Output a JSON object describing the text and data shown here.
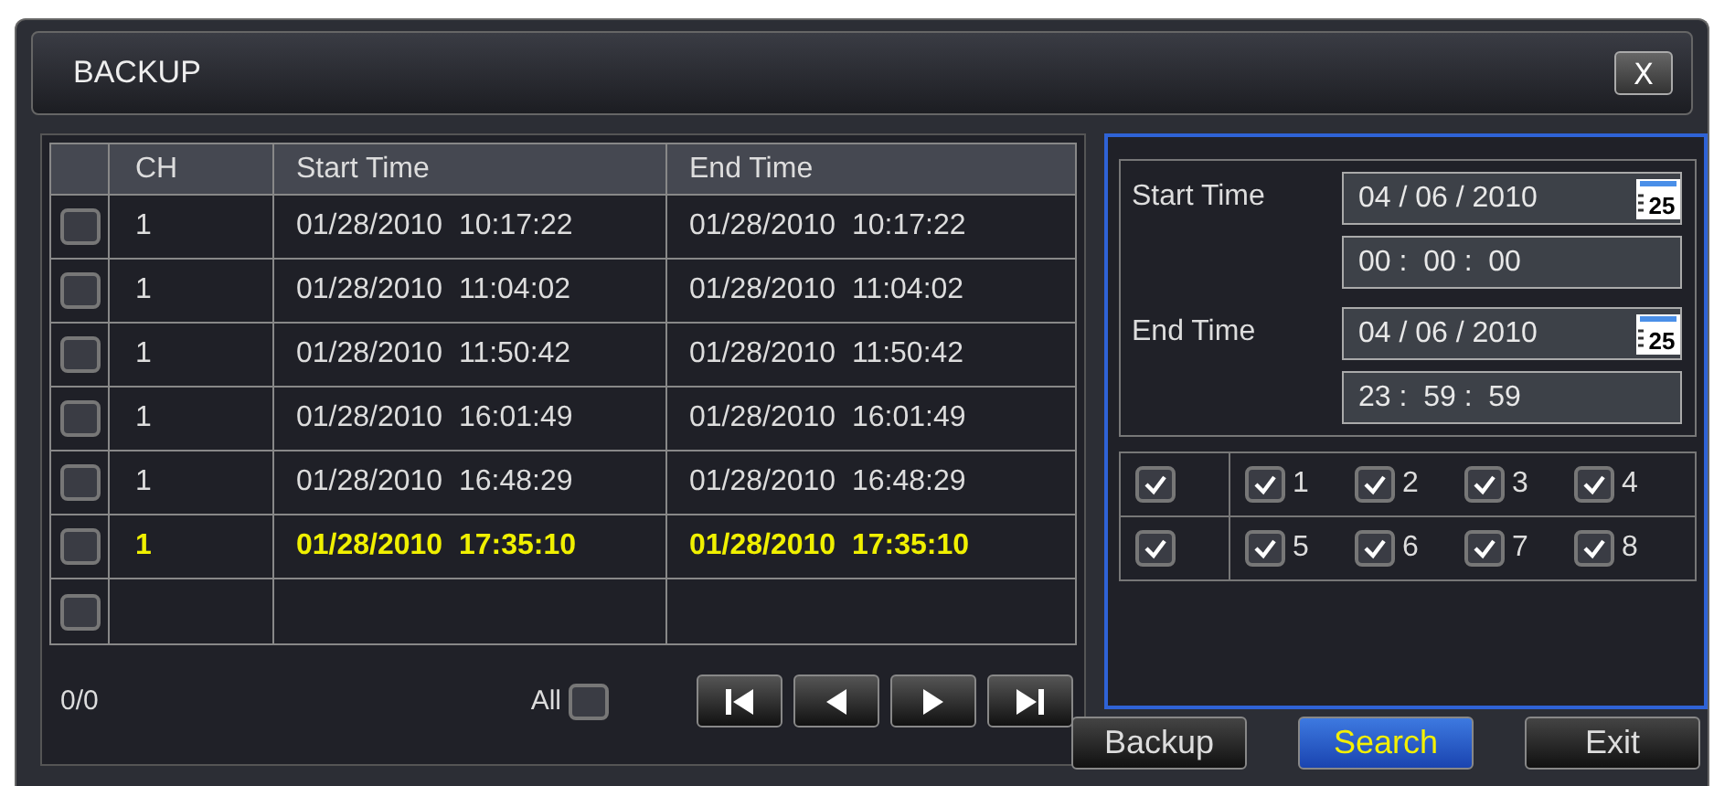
{
  "window": {
    "title": "BACKUP",
    "close": "X"
  },
  "table": {
    "columns": [
      "CH",
      "Start Time",
      "End Time"
    ],
    "rows": [
      {
        "checked": false,
        "selected": false,
        "ch": "1",
        "start": "01/28/2010  10:17:22",
        "end": "01/28/2010  10:17:22"
      },
      {
        "checked": false,
        "selected": false,
        "ch": "1",
        "start": "01/28/2010  11:04:02",
        "end": "01/28/2010  11:04:02"
      },
      {
        "checked": false,
        "selected": false,
        "ch": "1",
        "start": "01/28/2010  11:50:42",
        "end": "01/28/2010  11:50:42"
      },
      {
        "checked": false,
        "selected": false,
        "ch": "1",
        "start": "01/28/2010  16:01:49",
        "end": "01/28/2010  16:01:49"
      },
      {
        "checked": false,
        "selected": false,
        "ch": "1",
        "start": "01/28/2010  16:48:29",
        "end": "01/28/2010  16:48:29"
      },
      {
        "checked": false,
        "selected": true,
        "ch": "1",
        "start": "01/28/2010  17:35:10",
        "end": "01/28/2010  17:35:10"
      },
      {
        "checked": false
      }
    ]
  },
  "pager": {
    "count": "0/0",
    "all_label": "All",
    "all_checked": false
  },
  "search": {
    "start_label": "Start Time",
    "start_date": "04 / 06 / 2010",
    "start_time": "00 :  00 :  00",
    "end_label": "End Time",
    "end_date": "04 / 06 / 2010",
    "end_time": "23 :  59 :  59",
    "start_calendar_day": "25",
    "end_calendar_day": "25",
    "channel_groups": [
      {
        "checked": true,
        "channels": [
          {
            "label": "1",
            "checked": true
          },
          {
            "label": "2",
            "checked": true
          },
          {
            "label": "3",
            "checked": true
          },
          {
            "label": "4",
            "checked": true
          }
        ]
      },
      {
        "checked": true,
        "channels": [
          {
            "label": "5",
            "checked": true
          },
          {
            "label": "6",
            "checked": true
          },
          {
            "label": "7",
            "checked": true
          },
          {
            "label": "8",
            "checked": true
          }
        ]
      }
    ]
  },
  "buttons": [
    {
      "label": "Backup",
      "selected": false
    },
    {
      "label": "Search",
      "selected": true
    },
    {
      "label": "Exit",
      "selected": false
    }
  ]
}
